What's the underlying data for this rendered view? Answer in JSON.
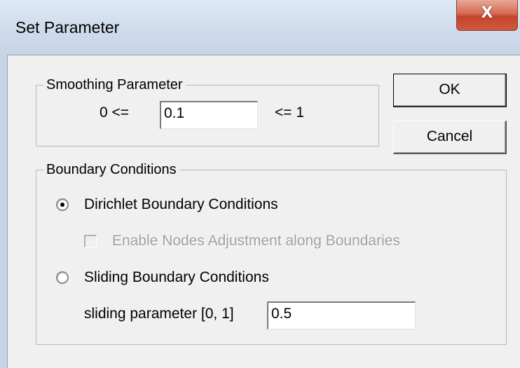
{
  "window": {
    "title": "Set Parameter",
    "close_icon": "close-icon",
    "close_glyph": "X"
  },
  "smoothing": {
    "group_label": "Smoothing Parameter",
    "min_label": "0 <=",
    "value": "0.1",
    "max_label": "<= 1"
  },
  "buttons": {
    "ok": "OK",
    "cancel": "Cancel"
  },
  "boundary": {
    "group_label": "Boundary Conditions",
    "dirichlet_label": "Dirichlet Boundary Conditions",
    "dirichlet_selected": true,
    "enable_nodes_label": "Enable Nodes Adjustment along Boundaries",
    "enable_nodes_checked": false,
    "enable_nodes_enabled": false,
    "sliding_label": "Sliding Boundary Conditions",
    "sliding_selected": false,
    "sliding_param_label": "sliding parameter [0, 1]",
    "sliding_param_value": "0.5"
  }
}
